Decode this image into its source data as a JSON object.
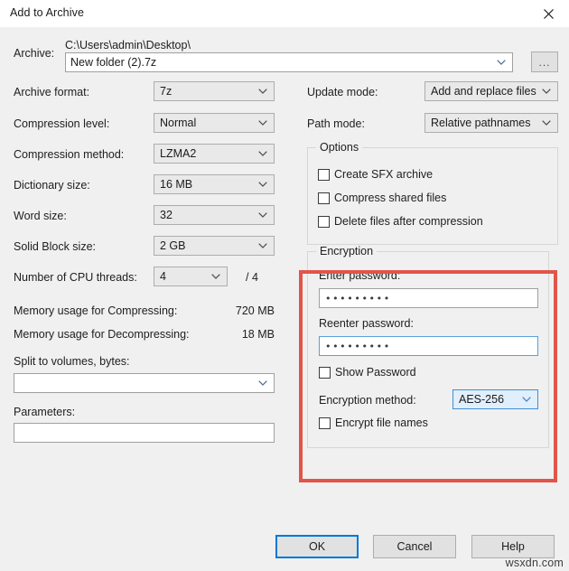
{
  "window": {
    "title": "Add to Archive",
    "close_icon": "close-icon"
  },
  "archive": {
    "label": "Archive:",
    "path": "C:\\Users\\admin\\Desktop\\",
    "filename": "New folder (2).7z",
    "browse_label": "..."
  },
  "left_fields": [
    {
      "label": "Archive format:",
      "value": "7z"
    },
    {
      "label": "Compression level:",
      "value": "Normal"
    },
    {
      "label": "Compression method:",
      "value": "LZMA2"
    },
    {
      "label": "Dictionary size:",
      "value": "16 MB"
    },
    {
      "label": "Word size:",
      "value": "32"
    },
    {
      "label": "Solid Block size:",
      "value": "2 GB"
    }
  ],
  "cpu_threads": {
    "label": "Number of CPU threads:",
    "value": "4",
    "total": "/ 4"
  },
  "memory": {
    "compress_label": "Memory usage for Compressing:",
    "compress_value": "720 MB",
    "decompress_label": "Memory usage for Decompressing:",
    "decompress_value": "18 MB"
  },
  "split": {
    "label": "Split to volumes, bytes:",
    "value": ""
  },
  "parameters": {
    "label": "Parameters:",
    "value": ""
  },
  "update_mode": {
    "label": "Update mode:",
    "value": "Add and replace files"
  },
  "path_mode": {
    "label": "Path mode:",
    "value": "Relative pathnames"
  },
  "options": {
    "title": "Options",
    "items": [
      {
        "label": "Create SFX archive",
        "checked": false
      },
      {
        "label": "Compress shared files",
        "checked": false
      },
      {
        "label": "Delete files after compression",
        "checked": false
      }
    ]
  },
  "encryption": {
    "title": "Encryption",
    "enter_password_label": "Enter password:",
    "enter_password_value": "•••••••••",
    "reenter_password_label": "Reenter password:",
    "reenter_password_value": "•••••••••",
    "show_password_label": "Show Password",
    "show_password_checked": false,
    "method_label": "Encryption method:",
    "method_value": "AES-256",
    "encrypt_names_label": "Encrypt file names",
    "encrypt_names_checked": false,
    "highlight_color": "#e2544a"
  },
  "buttons": {
    "ok": "OK",
    "cancel": "Cancel",
    "help": "Help"
  },
  "watermark": "wsxdn.com"
}
